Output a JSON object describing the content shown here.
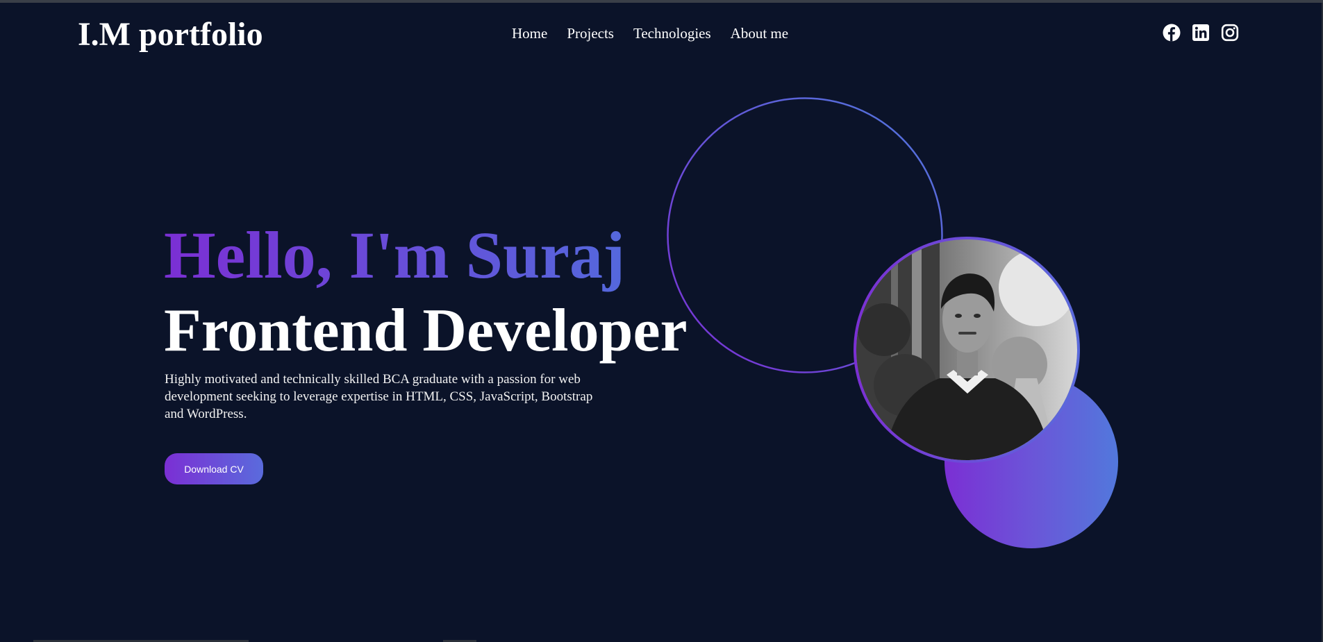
{
  "header": {
    "logo": "I.M portfolio",
    "nav": [
      {
        "label": "Home"
      },
      {
        "label": "Projects"
      },
      {
        "label": "Technologies"
      },
      {
        "label": "About me"
      }
    ],
    "social_icons": [
      "facebook-icon",
      "linkedin-icon",
      "instagram-icon"
    ]
  },
  "hero": {
    "greeting": "Hello, I'm Suraj",
    "role": "Frontend Developer",
    "bio": "Highly motivated and technically skilled BCA graduate with a passion for web development seeking to leverage expertise in HTML, CSS, JavaScript, Bootstrap and WordPress.",
    "button_label": "Download CV"
  },
  "colors": {
    "background": "#0b1329",
    "gradient_start": "#7b2fd4",
    "gradient_end": "#5a6bdc",
    "text": "#ffffff"
  }
}
